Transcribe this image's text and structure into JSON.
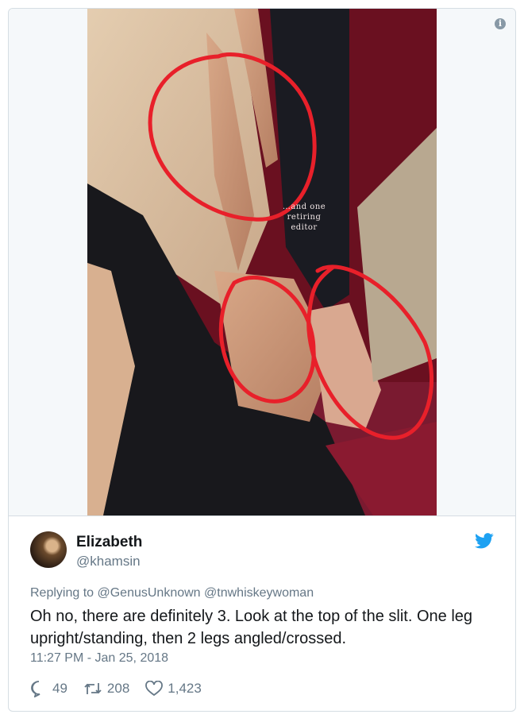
{
  "media": {
    "caption": "…and one retiring editor",
    "info_icon": "info-icon"
  },
  "tweet": {
    "name": "Elizabeth",
    "handle": "@khamsin",
    "replying_to": "Replying to @GenusUnknown @tnwhiskeywoman",
    "text": "Oh no, there are definitely 3. Look at the top of the slit. One leg upright/standing, then 2 legs angled/crossed.",
    "timestamp": "11:27 PM - Jan 25, 2018",
    "replies": "49",
    "retweets": "208",
    "likes": "1,423"
  },
  "colors": {
    "brand": "#1da1f2",
    "muted": "#657786",
    "annotation": "#e8202a"
  }
}
